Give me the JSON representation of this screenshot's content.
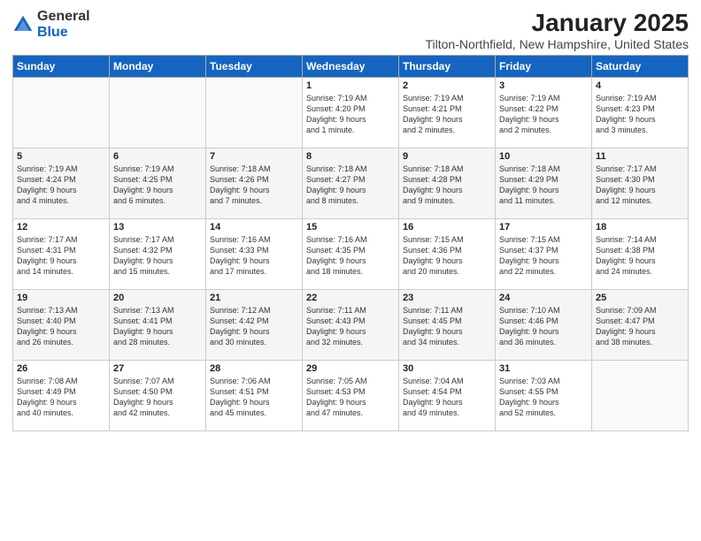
{
  "logo": {
    "general": "General",
    "blue": "Blue"
  },
  "header": {
    "month": "January 2025",
    "location": "Tilton-Northfield, New Hampshire, United States"
  },
  "days_of_week": [
    "Sunday",
    "Monday",
    "Tuesday",
    "Wednesday",
    "Thursday",
    "Friday",
    "Saturday"
  ],
  "weeks": [
    [
      {
        "day": "",
        "content": ""
      },
      {
        "day": "",
        "content": ""
      },
      {
        "day": "",
        "content": ""
      },
      {
        "day": "1",
        "content": "Sunrise: 7:19 AM\nSunset: 4:20 PM\nDaylight: 9 hours\nand 1 minute."
      },
      {
        "day": "2",
        "content": "Sunrise: 7:19 AM\nSunset: 4:21 PM\nDaylight: 9 hours\nand 2 minutes."
      },
      {
        "day": "3",
        "content": "Sunrise: 7:19 AM\nSunset: 4:22 PM\nDaylight: 9 hours\nand 2 minutes."
      },
      {
        "day": "4",
        "content": "Sunrise: 7:19 AM\nSunset: 4:23 PM\nDaylight: 9 hours\nand 3 minutes."
      }
    ],
    [
      {
        "day": "5",
        "content": "Sunrise: 7:19 AM\nSunset: 4:24 PM\nDaylight: 9 hours\nand 4 minutes."
      },
      {
        "day": "6",
        "content": "Sunrise: 7:19 AM\nSunset: 4:25 PM\nDaylight: 9 hours\nand 6 minutes."
      },
      {
        "day": "7",
        "content": "Sunrise: 7:18 AM\nSunset: 4:26 PM\nDaylight: 9 hours\nand 7 minutes."
      },
      {
        "day": "8",
        "content": "Sunrise: 7:18 AM\nSunset: 4:27 PM\nDaylight: 9 hours\nand 8 minutes."
      },
      {
        "day": "9",
        "content": "Sunrise: 7:18 AM\nSunset: 4:28 PM\nDaylight: 9 hours\nand 9 minutes."
      },
      {
        "day": "10",
        "content": "Sunrise: 7:18 AM\nSunset: 4:29 PM\nDaylight: 9 hours\nand 11 minutes."
      },
      {
        "day": "11",
        "content": "Sunrise: 7:17 AM\nSunset: 4:30 PM\nDaylight: 9 hours\nand 12 minutes."
      }
    ],
    [
      {
        "day": "12",
        "content": "Sunrise: 7:17 AM\nSunset: 4:31 PM\nDaylight: 9 hours\nand 14 minutes."
      },
      {
        "day": "13",
        "content": "Sunrise: 7:17 AM\nSunset: 4:32 PM\nDaylight: 9 hours\nand 15 minutes."
      },
      {
        "day": "14",
        "content": "Sunrise: 7:16 AM\nSunset: 4:33 PM\nDaylight: 9 hours\nand 17 minutes."
      },
      {
        "day": "15",
        "content": "Sunrise: 7:16 AM\nSunset: 4:35 PM\nDaylight: 9 hours\nand 18 minutes."
      },
      {
        "day": "16",
        "content": "Sunrise: 7:15 AM\nSunset: 4:36 PM\nDaylight: 9 hours\nand 20 minutes."
      },
      {
        "day": "17",
        "content": "Sunrise: 7:15 AM\nSunset: 4:37 PM\nDaylight: 9 hours\nand 22 minutes."
      },
      {
        "day": "18",
        "content": "Sunrise: 7:14 AM\nSunset: 4:38 PM\nDaylight: 9 hours\nand 24 minutes."
      }
    ],
    [
      {
        "day": "19",
        "content": "Sunrise: 7:13 AM\nSunset: 4:40 PM\nDaylight: 9 hours\nand 26 minutes."
      },
      {
        "day": "20",
        "content": "Sunrise: 7:13 AM\nSunset: 4:41 PM\nDaylight: 9 hours\nand 28 minutes."
      },
      {
        "day": "21",
        "content": "Sunrise: 7:12 AM\nSunset: 4:42 PM\nDaylight: 9 hours\nand 30 minutes."
      },
      {
        "day": "22",
        "content": "Sunrise: 7:11 AM\nSunset: 4:43 PM\nDaylight: 9 hours\nand 32 minutes."
      },
      {
        "day": "23",
        "content": "Sunrise: 7:11 AM\nSunset: 4:45 PM\nDaylight: 9 hours\nand 34 minutes."
      },
      {
        "day": "24",
        "content": "Sunrise: 7:10 AM\nSunset: 4:46 PM\nDaylight: 9 hours\nand 36 minutes."
      },
      {
        "day": "25",
        "content": "Sunrise: 7:09 AM\nSunset: 4:47 PM\nDaylight: 9 hours\nand 38 minutes."
      }
    ],
    [
      {
        "day": "26",
        "content": "Sunrise: 7:08 AM\nSunset: 4:49 PM\nDaylight: 9 hours\nand 40 minutes."
      },
      {
        "day": "27",
        "content": "Sunrise: 7:07 AM\nSunset: 4:50 PM\nDaylight: 9 hours\nand 42 minutes."
      },
      {
        "day": "28",
        "content": "Sunrise: 7:06 AM\nSunset: 4:51 PM\nDaylight: 9 hours\nand 45 minutes."
      },
      {
        "day": "29",
        "content": "Sunrise: 7:05 AM\nSunset: 4:53 PM\nDaylight: 9 hours\nand 47 minutes."
      },
      {
        "day": "30",
        "content": "Sunrise: 7:04 AM\nSunset: 4:54 PM\nDaylight: 9 hours\nand 49 minutes."
      },
      {
        "day": "31",
        "content": "Sunrise: 7:03 AM\nSunset: 4:55 PM\nDaylight: 9 hours\nand 52 minutes."
      },
      {
        "day": "",
        "content": ""
      }
    ]
  ]
}
